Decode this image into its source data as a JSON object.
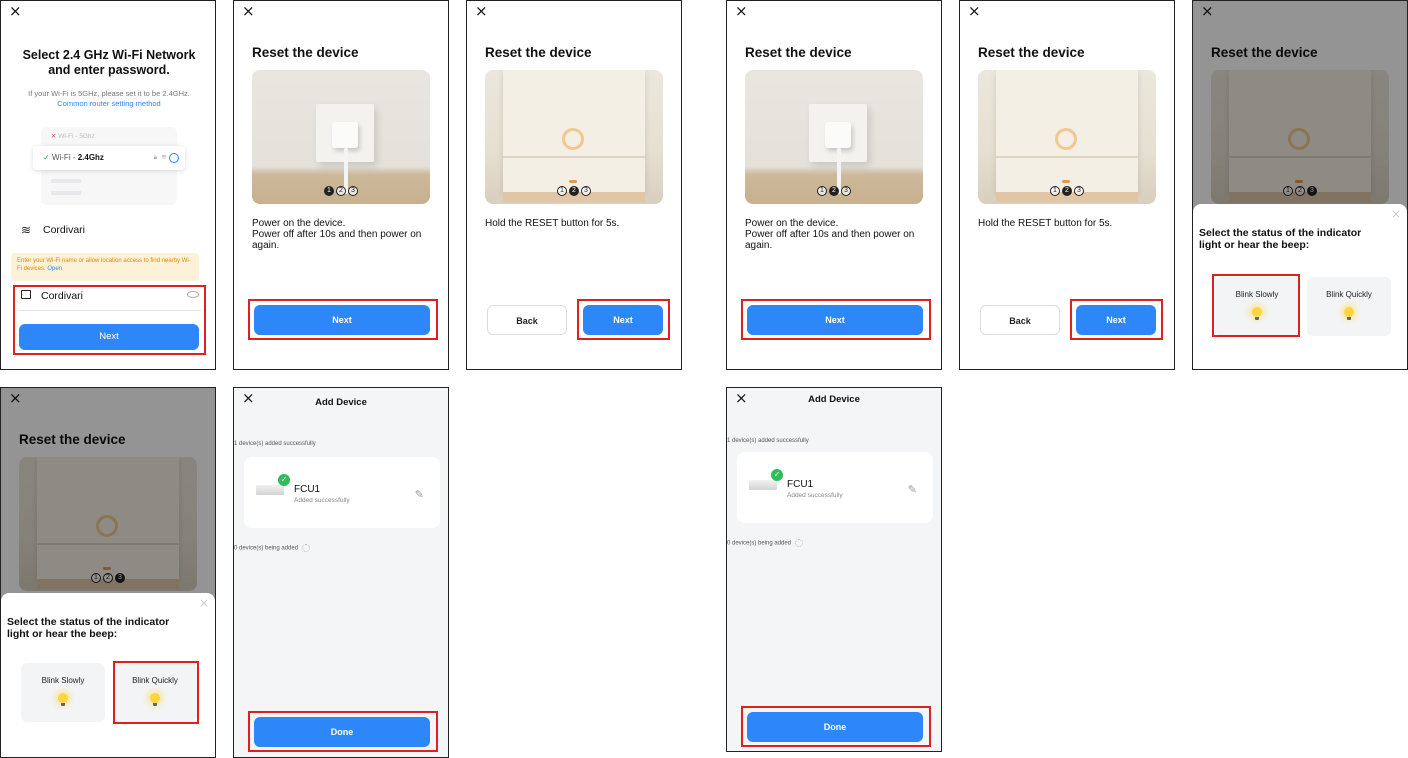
{
  "close_icon": "×",
  "wifi_screen": {
    "title": "Select 2.4 GHz Wi-Fi Network and enter password.",
    "subtitle": "If your Wi-Fi is 5GHz, please set it to be 2.4GHz.",
    "router_link": "Common router setting method",
    "wifi_5g_label": "Wi-Fi - 5Ghz",
    "wifi_24_prefix": "Wi-Fi - ",
    "wifi_24_band": "2.4Ghz",
    "network_name": "Cordivari",
    "warning_text": "Enter your Wi-Fi name or allow location access to find nearby Wi-Fi devices.",
    "warning_link": "Open",
    "password_value": "Cordivari",
    "next_label": "Next"
  },
  "reset": {
    "title": "Reset the device",
    "step1_text": "Power on the device.\nPower off after 10s and then power on again.",
    "step2_text": "Hold the RESET button for 5s.",
    "next_label": "Next",
    "back_label": "Back",
    "pager": [
      "1",
      "2",
      "3"
    ]
  },
  "indicator": {
    "title": "Select the status of the indicator light or hear the beep:",
    "blink_slowly": "Blink Slowly",
    "blink_quickly": "Blink Quickly"
  },
  "add_device": {
    "header": "Add Device",
    "added_count": "1 device(s) added successfully",
    "device_name": "FCU1",
    "device_status": "Added successfully",
    "adding_count": "0 device(s) being added",
    "done_label": "Done"
  },
  "colors": {
    "primary": "#2e87f8",
    "highlight": "#e02020",
    "success": "#2fbd5a",
    "bulb": "#ffd53d"
  }
}
